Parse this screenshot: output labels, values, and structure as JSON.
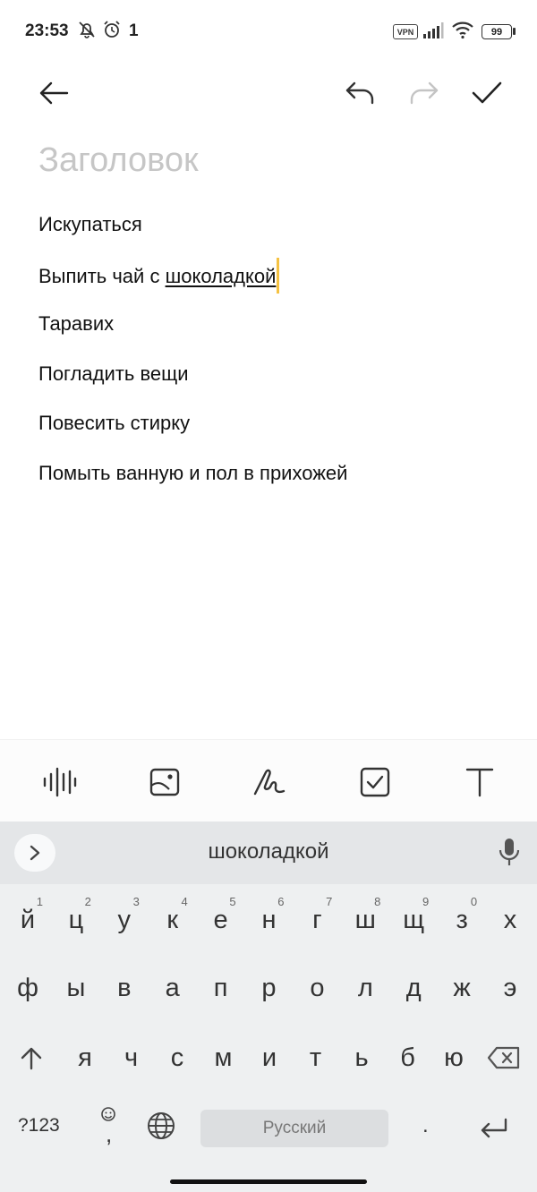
{
  "status": {
    "time": "23:53",
    "vpn": "VPN",
    "battery": "99",
    "notif_count": "1"
  },
  "toolbar": {
    "back": "back-arrow",
    "undo": "undo",
    "redo": "redo",
    "done": "check"
  },
  "note": {
    "title_placeholder": "Заголовок",
    "lines": [
      "Искупаться",
      "Выпить чай с ",
      "Таравих",
      "Погладить вещи",
      "Повесить стирку",
      "Помыть ванную и пол в прихожей"
    ],
    "underlined_word": "шоколадкой"
  },
  "keyboard": {
    "suggestion": "шоколадкой",
    "row1": [
      "й",
      "ц",
      "у",
      "к",
      "е",
      "н",
      "г",
      "ш",
      "щ",
      "з",
      "х"
    ],
    "row1_hints": [
      "1",
      "2",
      "3",
      "4",
      "5",
      "6",
      "7",
      "8",
      "9",
      "0",
      ""
    ],
    "row2": [
      "ф",
      "ы",
      "в",
      "а",
      "п",
      "р",
      "о",
      "л",
      "д",
      "ж",
      "э"
    ],
    "row3": [
      "я",
      "ч",
      "с",
      "м",
      "и",
      "т",
      "ь",
      "б",
      "ю"
    ],
    "symbols_label": "?123",
    "comma": ",",
    "space_label": "Русский",
    "period": "."
  },
  "colors": {
    "accent_cursor": "#f5c242",
    "placeholder": "#c6c6c6"
  }
}
